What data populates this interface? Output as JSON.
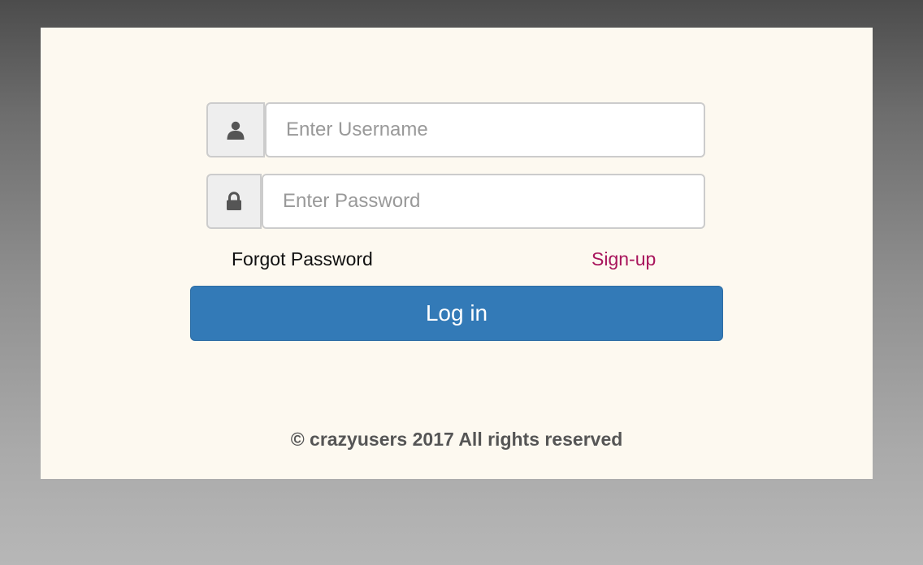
{
  "login_form": {
    "username": {
      "icon": "user-icon",
      "placeholder": "Enter Username",
      "value": ""
    },
    "password": {
      "icon": "lock-icon",
      "placeholder": "Enter Password",
      "value": ""
    },
    "forgot_password_label": "Forgot Password",
    "signup_label": "Sign-up",
    "login_button_label": "Log in"
  },
  "footer": {
    "copyright": "© crazyusers 2017 All rights reserved"
  },
  "colors": {
    "card_background": "#fdf9f0",
    "primary_button": "#337ab7",
    "signup_link": "#a8155c",
    "footer_text": "#555555"
  }
}
